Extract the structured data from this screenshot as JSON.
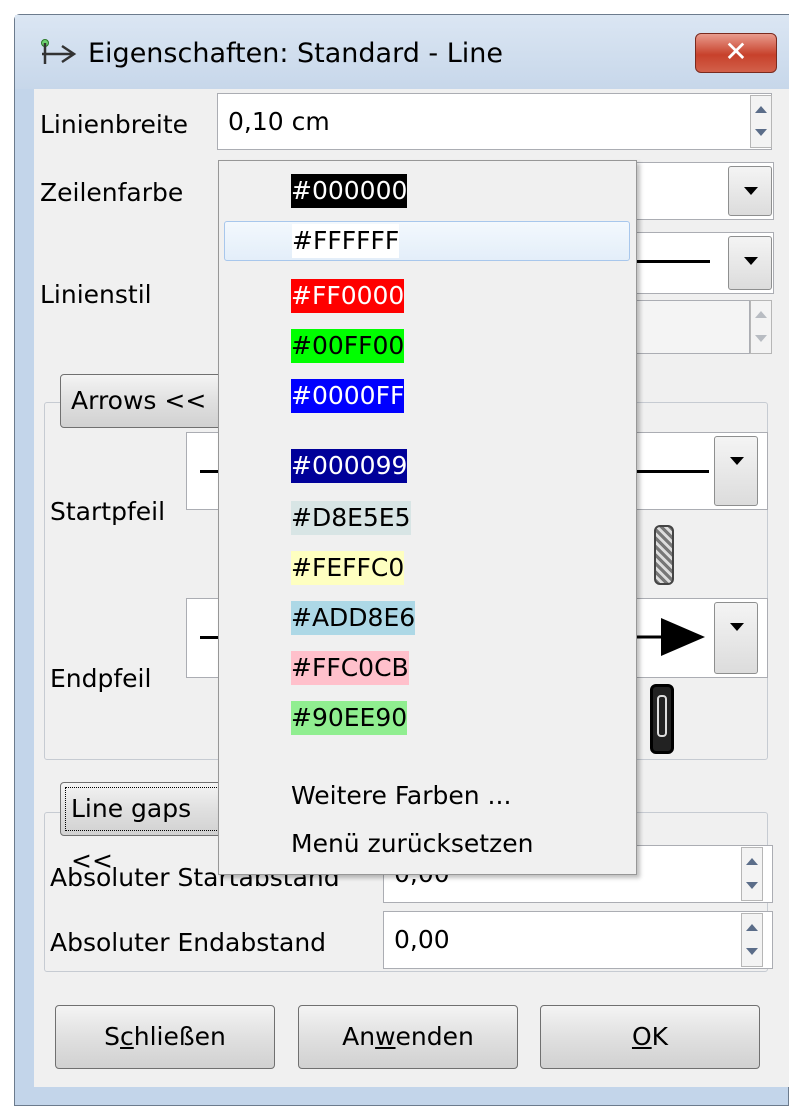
{
  "window": {
    "title": "Eigenschaften: Standard - Line",
    "close_label": "✕"
  },
  "line_width": {
    "label": "Linienbreite",
    "value": "0,10 cm"
  },
  "line_color": {
    "label": "Zeilenfarbe"
  },
  "line_style": {
    "label": "Linienstil"
  },
  "arrows_section": {
    "toggle_label": "Arrows <<"
  },
  "start_arrow": {
    "label": "Startpfeil"
  },
  "end_arrow": {
    "label": "Endpfeil"
  },
  "gaps_section": {
    "toggle_label": "Line gaps <<"
  },
  "start_gap": {
    "label": "Absoluter Startabstand",
    "value": "0,00"
  },
  "end_gap": {
    "label": "Absoluter Endabstand",
    "value": "0,00"
  },
  "buttons": {
    "close": {
      "pre": "S",
      "u": "c",
      "post": "hließen"
    },
    "apply": {
      "pre": "An",
      "u": "w",
      "post": "enden"
    },
    "ok": {
      "pre": "",
      "u": "O",
      "post": "K"
    }
  },
  "color_menu": {
    "colors": [
      {
        "label": "#000000",
        "bg": "#000000",
        "fg": "#ffffff"
      },
      {
        "label": "#FFFFFF",
        "bg": "#FFFFFF",
        "fg": "#000000"
      },
      {
        "label": "#FF0000",
        "bg": "#FF0000",
        "fg": "#ffffff"
      },
      {
        "label": "#00FF00",
        "bg": "#00FF00",
        "fg": "#000000"
      },
      {
        "label": "#0000FF",
        "bg": "#0000FF",
        "fg": "#ffffff"
      },
      {
        "label": "#000099",
        "bg": "#000099",
        "fg": "#ffffff"
      },
      {
        "label": "#D8E5E5",
        "bg": "#D8E5E5",
        "fg": "#000000"
      },
      {
        "label": "#FEFFC0",
        "bg": "#FEFFC0",
        "fg": "#000000"
      },
      {
        "label": "#ADD8E6",
        "bg": "#ADD8E6",
        "fg": "#000000"
      },
      {
        "label": "#FFC0CB",
        "bg": "#FFC0CB",
        "fg": "#000000"
      },
      {
        "label": "#90EE90",
        "bg": "#90EE90",
        "fg": "#000000"
      }
    ],
    "more_colors": "Weitere Farben ...",
    "reset_menu": "Menü zurücksetzen"
  }
}
